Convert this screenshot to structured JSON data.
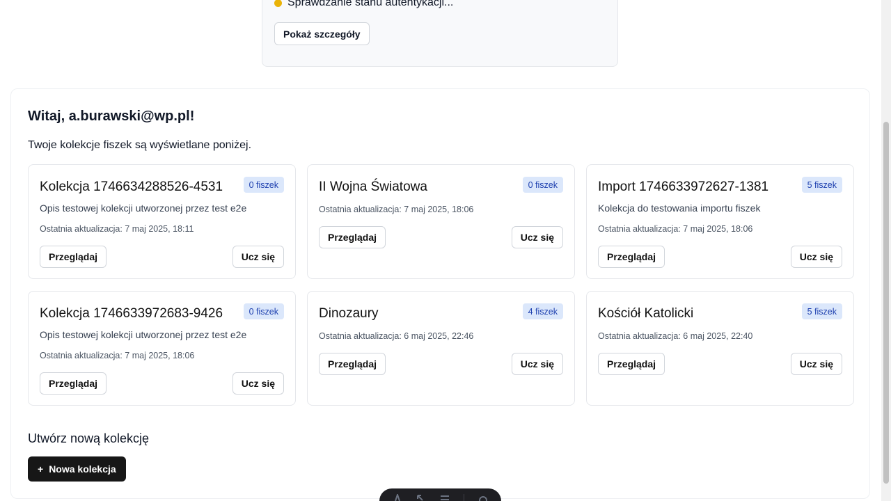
{
  "auth": {
    "status_text": "Sprawdzanie stanu autentykacji...",
    "details_button": "Pokaż szczegóły"
  },
  "main": {
    "welcome": "Witaj, a.burawski@wp.pl!",
    "subtitle": "Twoje kolekcje fiszek są wyświetlane poniżej.",
    "browse_label": "Przeglądaj",
    "learn_label": "Ucz się",
    "collections": [
      {
        "title": "Kolekcja 1746634288526-4531",
        "badge": "0 fiszek",
        "description": "Opis testowej kolekcji utworzonej przez test e2e",
        "updated": "Ostatnia aktualizacja: 7 maj 2025, 18:11"
      },
      {
        "title": "II Wojna Światowa",
        "badge": "0 fiszek",
        "description": "",
        "updated": "Ostatnia aktualizacja: 7 maj 2025, 18:06"
      },
      {
        "title": "Import 1746633972627-1381",
        "badge": "5 fiszek",
        "description": "Kolekcja do testowania importu fiszek",
        "updated": "Ostatnia aktualizacja: 7 maj 2025, 18:06"
      },
      {
        "title": "Kolekcja 1746633972683-9426",
        "badge": "0 fiszek",
        "description": "Opis testowej kolekcji utworzonej przez test e2e",
        "updated": "Ostatnia aktualizacja: 7 maj 2025, 18:06"
      },
      {
        "title": "Dinozaury",
        "badge": "4 fiszek",
        "description": "",
        "updated": "Ostatnia aktualizacja: 6 maj 2025, 22:46"
      },
      {
        "title": "Kościół Katolicki",
        "badge": "5 fiszek",
        "description": "",
        "updated": "Ostatnia aktualizacja: 6 maj 2025, 22:40"
      }
    ],
    "create_title": "Utwórz nową kolekcję",
    "new_button_icon": "+",
    "new_button_label": "Nowa kolekcja"
  },
  "toolbar": {
    "icons": [
      "astro-icon",
      "inspect-icon",
      "menu-icon",
      "settings-icon"
    ]
  },
  "colors": {
    "status_dot": "#eab308",
    "badge_bg": "#dbe7fb",
    "badge_text": "#1e40af",
    "primary_button": "#171717"
  }
}
